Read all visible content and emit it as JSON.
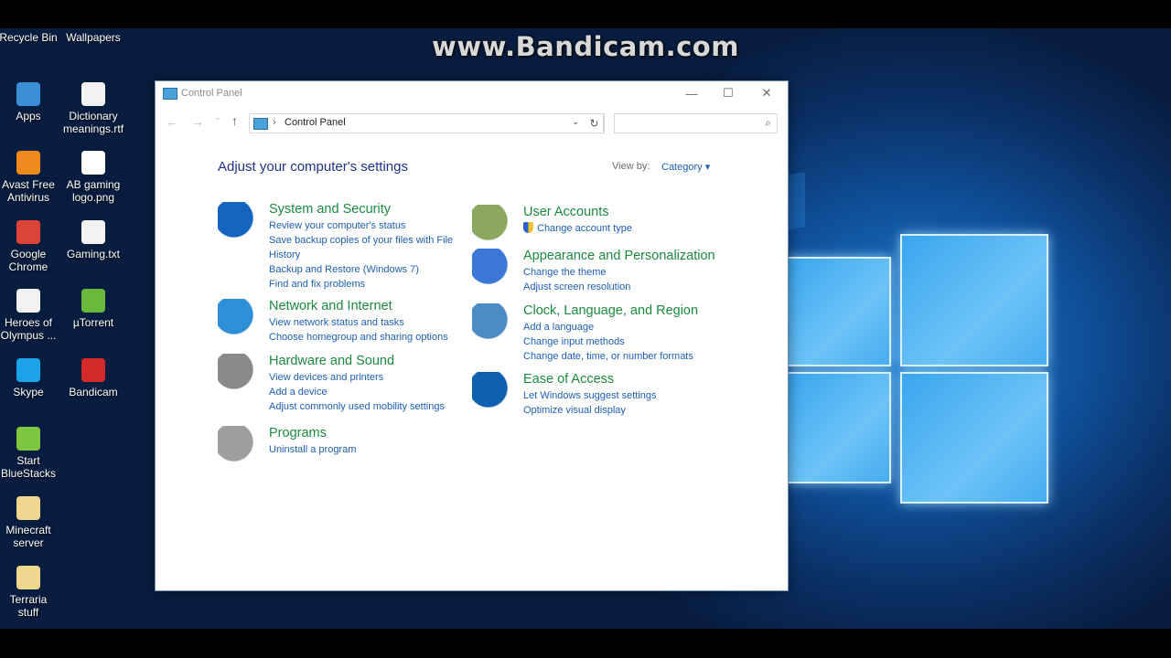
{
  "watermark": "www.Bandicam.com",
  "desktop_icons": [
    {
      "label": "Recycle Bin",
      "icon": "recycle-bin-icon",
      "color": "#c9c9c9"
    },
    {
      "label": "Wallpapers",
      "icon": "folder-icon",
      "color": "#e8c45d"
    },
    {
      "label": "Apps",
      "icon": "apps-icon",
      "color": "#3a8fd6"
    },
    {
      "label": "Dictionary meanings.rtf",
      "icon": "document-icon",
      "color": "#f2f2f2"
    },
    {
      "label": "Avast Free Antivirus",
      "icon": "avast-icon",
      "color": "#f08a1c"
    },
    {
      "label": "AB gaming logo.png",
      "icon": "image-icon",
      "color": "#ffffff"
    },
    {
      "label": "Google Chrome",
      "icon": "chrome-icon",
      "color": "#db4437"
    },
    {
      "label": "Gaming.txt",
      "icon": "text-file-icon",
      "color": "#f2f2f2"
    },
    {
      "label": "Heroes of Olympus ...",
      "icon": "pdf-icon",
      "color": "#f2f2f2"
    },
    {
      "label": "µTorrent",
      "icon": "utorrent-icon",
      "color": "#6ab83c"
    },
    {
      "label": "Skype",
      "icon": "skype-icon",
      "color": "#1aa3e8"
    },
    {
      "label": "Bandicam",
      "icon": "bandicam-icon",
      "color": "#d42a2a"
    },
    {
      "label": "Start BlueStacks",
      "icon": "bluestacks-icon",
      "color": "#7ec540"
    },
    {
      "label": "Minecraft server",
      "icon": "folder-icon",
      "color": "#f0d78f"
    },
    {
      "label": "Terraria stuff",
      "icon": "folder-icon",
      "color": "#f0d78f"
    }
  ],
  "window": {
    "title": "Control Panel",
    "controls": {
      "minimize": "—",
      "maximize": "☐",
      "close": "✕"
    },
    "nav": {
      "back": "←",
      "forward": "→",
      "recent": "⌄",
      "up": "↑"
    },
    "address": {
      "separator": "›",
      "path": "Control Panel",
      "dropdown": "⌄"
    },
    "refresh": "↻",
    "search": {
      "placeholder": "",
      "icon": "⌕"
    },
    "heading": "Adjust your computer's settings",
    "view_by": {
      "label": "View by:",
      "value": "Category ▾"
    },
    "categories": [
      {
        "title": "System and Security",
        "icon": "shield-icon",
        "links": [
          "Review your computer's status",
          "Save backup copies of your files with File History",
          "Backup and Restore (Windows 7)",
          "Find and fix problems"
        ]
      },
      {
        "title": "Network and Internet",
        "icon": "network-icon",
        "links": [
          "View network status and tasks",
          "Choose homegroup and sharing options"
        ]
      },
      {
        "title": "Hardware and Sound",
        "icon": "printer-icon",
        "links": [
          "View devices and printers",
          "Add a device",
          "Adjust commonly used mobility settings"
        ]
      },
      {
        "title": "Programs",
        "icon": "programs-icon",
        "links": [
          "Uninstall a program"
        ]
      },
      {
        "title": "User Accounts",
        "icon": "users-icon",
        "links": [
          "Change account type"
        ]
      },
      {
        "title": "Appearance and Personalization",
        "icon": "appearance-icon",
        "links": [
          "Change the theme",
          "Adjust screen resolution"
        ]
      },
      {
        "title": "Clock, Language, and Region",
        "icon": "clock-globe-icon",
        "links": [
          "Add a language",
          "Change input methods",
          "Change date, time, or number formats"
        ]
      },
      {
        "title": "Ease of Access",
        "icon": "ease-of-access-icon",
        "links": [
          "Let Windows suggest settings",
          "Optimize visual display"
        ]
      }
    ]
  }
}
